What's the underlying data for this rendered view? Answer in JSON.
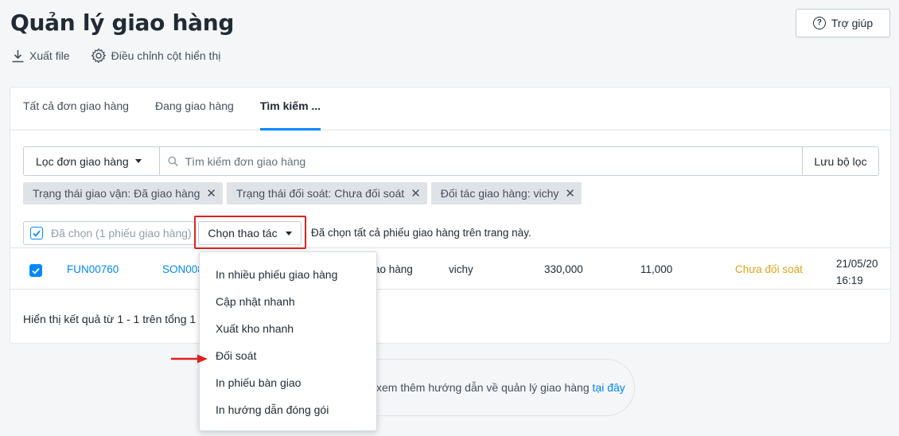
{
  "page": {
    "title": "Quản lý giao hàng"
  },
  "help": {
    "label": "Trợ giúp"
  },
  "actions": {
    "export_label": "Xuất file",
    "columns_label": "Điều chỉnh cột hiển thị"
  },
  "tabs": [
    {
      "label": "Tất cả đơn giao hàng"
    },
    {
      "label": "Đang giao hàng"
    },
    {
      "label": "Tìm kiếm ..."
    }
  ],
  "search": {
    "filter_label": "Lọc đơn giao hàng",
    "placeholder": "Tìm kiếm đơn giao hàng",
    "save_label": "Lưu bộ lọc"
  },
  "filters": [
    {
      "label": "Trạng thái giao vận: Đã giao hàng"
    },
    {
      "label": "Trạng thái đối soát: Chưa đối soát"
    },
    {
      "label": "Đối tác giao hàng: vichy"
    }
  ],
  "bulk": {
    "selected_label": "Đã chọn (1 phiếu giao hàng)",
    "choose_action_label": "Chọn thao tác",
    "select_all_text": "Đã chọn tất cả phiếu giao hàng trên trang này."
  },
  "row": {
    "code": "FUN00760",
    "order": "SON008",
    "delivery_status": "ao hàng",
    "partner": "vichy",
    "amount": "330,000",
    "fee": "11,000",
    "reconcile_status": "Chưa đối soát",
    "date": "21/05/20",
    "time": "16:19"
  },
  "results_text": "Hiển thị kết quả từ 1 - 1 trên tổng 1",
  "hint": {
    "text": "xem thêm hướng dẫn về quản lý giao hàng ",
    "link": "tại đây"
  },
  "menu": [
    {
      "label": "In nhiều phiếu giao hàng"
    },
    {
      "label": "Cập nhật nhanh"
    },
    {
      "label": "Xuất kho nhanh"
    },
    {
      "label": "Đối soát"
    },
    {
      "label": "In phiếu bàn giao"
    },
    {
      "label": "In hướng dẫn đóng gói"
    }
  ],
  "colors": {
    "accent": "#0088ff",
    "highlight": "#e02020",
    "pending": "#e0a419"
  }
}
